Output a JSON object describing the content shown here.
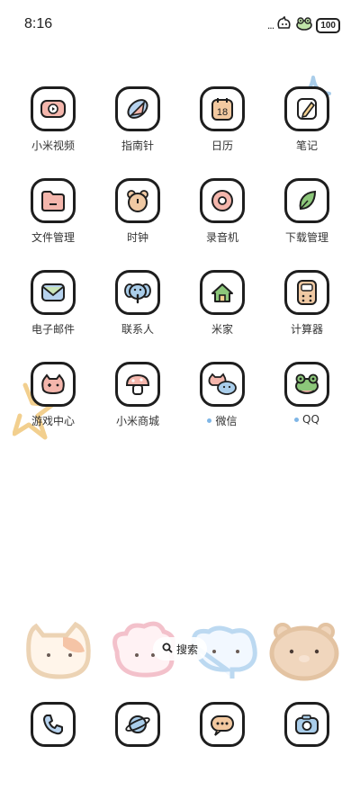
{
  "status_bar": {
    "time": "8:16",
    "signal": "...",
    "battery": "100"
  },
  "apps": [
    {
      "label": "小米视频",
      "icon": "video-icon",
      "dot": false
    },
    {
      "label": "指南针",
      "icon": "compass-icon",
      "dot": false
    },
    {
      "label": "日历",
      "icon": "calendar-icon",
      "dot": false,
      "date": "18"
    },
    {
      "label": "笔记",
      "icon": "notes-icon",
      "dot": false
    },
    {
      "label": "文件管理",
      "icon": "folder-icon",
      "dot": false
    },
    {
      "label": "时钟",
      "icon": "bear-clock-icon",
      "dot": false
    },
    {
      "label": "录音机",
      "icon": "recorder-icon",
      "dot": false
    },
    {
      "label": "下载管理",
      "icon": "leaf-download-icon",
      "dot": false
    },
    {
      "label": "电子邮件",
      "icon": "mail-icon",
      "dot": false
    },
    {
      "label": "联系人",
      "icon": "elephant-contacts-icon",
      "dot": false
    },
    {
      "label": "米家",
      "icon": "home-icon",
      "dot": false
    },
    {
      "label": "计算器",
      "icon": "calculator-icon",
      "dot": false
    },
    {
      "label": "游戏中心",
      "icon": "gamepad-icon",
      "dot": false
    },
    {
      "label": "小米商城",
      "icon": "mushroom-store-icon",
      "dot": false
    },
    {
      "label": "微信",
      "icon": "wechat-icon",
      "dot": true
    },
    {
      "label": "QQ",
      "icon": "frog-qq-icon",
      "dot": true
    }
  ],
  "search": {
    "label": "搜索"
  },
  "dock": [
    {
      "name": "phone",
      "icon": "phone-icon"
    },
    {
      "name": "browser",
      "icon": "planet-browser-icon"
    },
    {
      "name": "messages",
      "icon": "message-bubble-icon"
    },
    {
      "name": "camera",
      "icon": "camera-icon"
    }
  ],
  "colors": {
    "outline": "#1e1e1e",
    "pink": "#f2aaa0",
    "blue": "#a9cdea",
    "green": "#8cc77a",
    "tan": "#e8c9a8",
    "dot": "#7fb6e6"
  }
}
